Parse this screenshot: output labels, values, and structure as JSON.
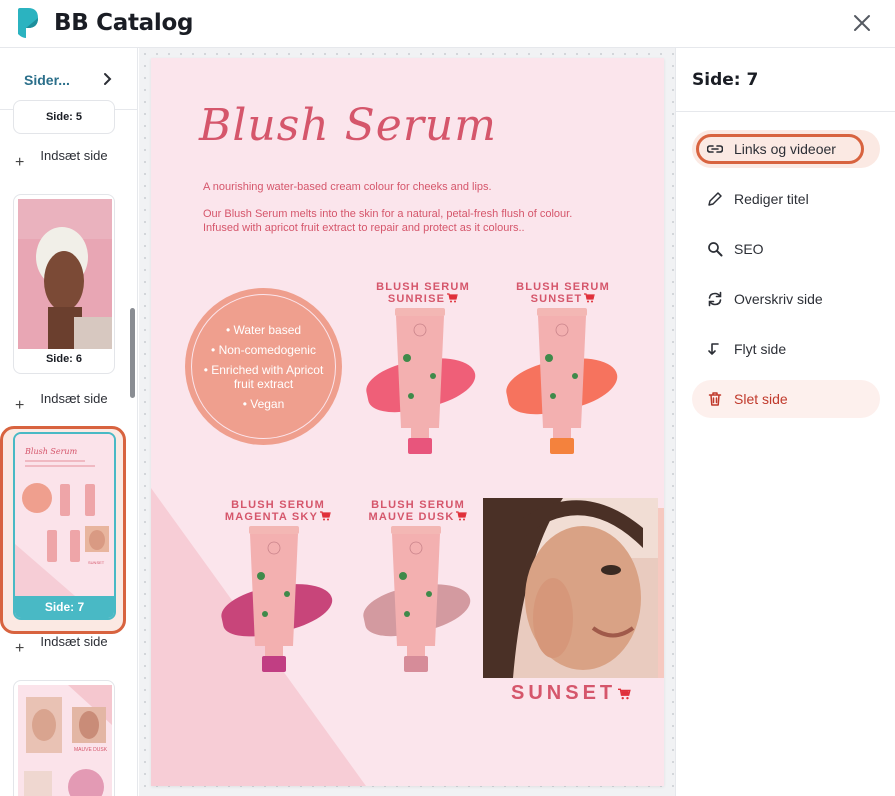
{
  "app": {
    "title": "BB Catalog"
  },
  "sidebar": {
    "header_label": "Sider...",
    "pages": [
      {
        "label": "Side: 5"
      },
      {
        "label": "Side: 6"
      },
      {
        "label": "Side: 7",
        "selected": true
      }
    ],
    "insert_label": "Indsæt side",
    "insert_plus": "+"
  },
  "page": {
    "title": "Blush Serum",
    "subtitle": "A nourishing water-based cream colour for cheeks and lips.",
    "description": "Our Blush Serum melts into the skin for a natural, petal-fresh flush of colour. Infused with apricot fruit extract to repair and protect as it colours..",
    "features": [
      "• Water based",
      "• Non-comedogenic",
      "• Enriched with Apricot fruit extract",
      "• Vegan"
    ],
    "products": [
      {
        "line1": "BLUSH SERUM",
        "line2": "SUNRISE"
      },
      {
        "line1": "BLUSH SERUM",
        "line2": "SUNSET"
      },
      {
        "line1": "BLUSH SERUM",
        "line2": "MAGENTA SKY"
      },
      {
        "line1": "BLUSH SERUM",
        "line2": "MAUVE DUSK"
      }
    ],
    "tube_text": "BLUSH SERUM",
    "portrait_caption": "SUNSET"
  },
  "panel": {
    "title": "Side: 7",
    "menu": [
      {
        "label": "Links og videoer",
        "icon": "link-icon"
      },
      {
        "label": "Rediger titel",
        "icon": "pencil-icon"
      },
      {
        "label": "SEO",
        "icon": "search-icon"
      },
      {
        "label": "Overskriv side",
        "icon": "refresh-icon"
      },
      {
        "label": "Flyt side",
        "icon": "move-icon"
      },
      {
        "label": "Slet side",
        "icon": "trash-icon"
      }
    ]
  },
  "colors": {
    "accent_teal": "#49b9c5",
    "highlight_orange": "#d8633f",
    "page_pink": "#fbe5ec",
    "text_rose": "#d5566b",
    "delete_red": "#c0392b"
  }
}
